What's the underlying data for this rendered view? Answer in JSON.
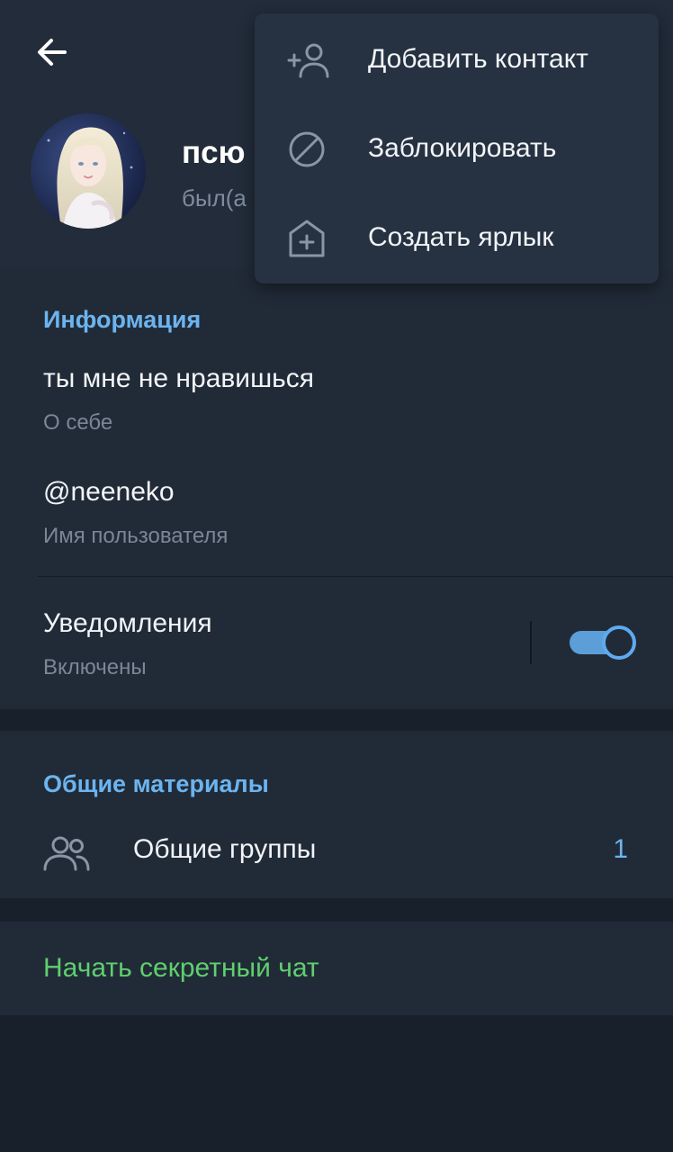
{
  "profile": {
    "name": "псю",
    "status": "был(а"
  },
  "info": {
    "title": "Информация",
    "bio": "ты мне не нравишься",
    "bio_caption": "О себе",
    "username": "@neeneko",
    "username_caption": "Имя пользователя",
    "notifications_label": "Уведомления",
    "notifications_status": "Включены",
    "notifications_on": true
  },
  "shared_media": {
    "title": "Общие материалы",
    "groups_label": "Общие группы",
    "groups_count": "1"
  },
  "secret_chat": {
    "label": "Начать секретный чат"
  },
  "menu": {
    "items": [
      {
        "label": "Добавить контакт",
        "icon": "add-contact-icon"
      },
      {
        "label": "Заблокировать",
        "icon": "block-icon"
      },
      {
        "label": "Создать ярлык",
        "icon": "add-shortcut-icon"
      }
    ]
  },
  "colors": {
    "background": "#18202b",
    "section": "#212b38",
    "accent": "#6cb4ef",
    "secret": "#5fcf6e",
    "menu": "#263242"
  }
}
